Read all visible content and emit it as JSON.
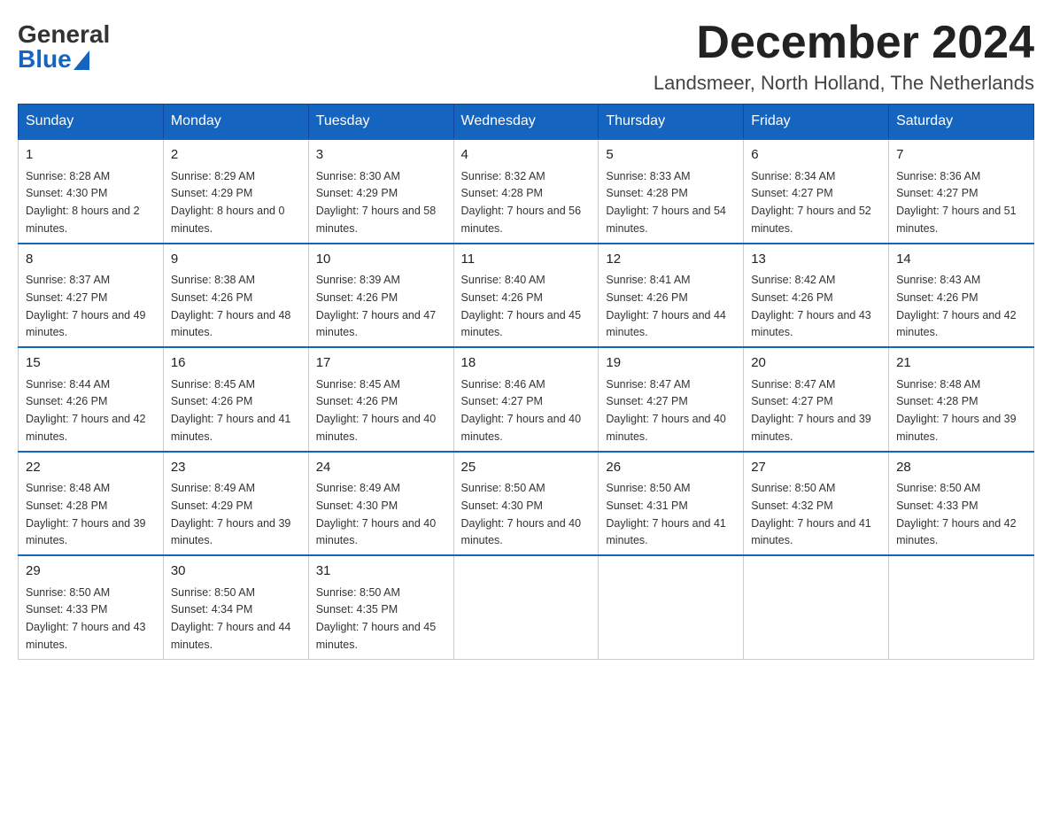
{
  "logo": {
    "general": "General",
    "blue": "Blue"
  },
  "title": "December 2024",
  "location": "Landsmeer, North Holland, The Netherlands",
  "weekdays": [
    "Sunday",
    "Monday",
    "Tuesday",
    "Wednesday",
    "Thursday",
    "Friday",
    "Saturday"
  ],
  "weeks": [
    [
      {
        "day": "1",
        "sunrise": "8:28 AM",
        "sunset": "4:30 PM",
        "daylight": "8 hours and 2 minutes."
      },
      {
        "day": "2",
        "sunrise": "8:29 AM",
        "sunset": "4:29 PM",
        "daylight": "8 hours and 0 minutes."
      },
      {
        "day": "3",
        "sunrise": "8:30 AM",
        "sunset": "4:29 PM",
        "daylight": "7 hours and 58 minutes."
      },
      {
        "day": "4",
        "sunrise": "8:32 AM",
        "sunset": "4:28 PM",
        "daylight": "7 hours and 56 minutes."
      },
      {
        "day": "5",
        "sunrise": "8:33 AM",
        "sunset": "4:28 PM",
        "daylight": "7 hours and 54 minutes."
      },
      {
        "day": "6",
        "sunrise": "8:34 AM",
        "sunset": "4:27 PM",
        "daylight": "7 hours and 52 minutes."
      },
      {
        "day": "7",
        "sunrise": "8:36 AM",
        "sunset": "4:27 PM",
        "daylight": "7 hours and 51 minutes."
      }
    ],
    [
      {
        "day": "8",
        "sunrise": "8:37 AM",
        "sunset": "4:27 PM",
        "daylight": "7 hours and 49 minutes."
      },
      {
        "day": "9",
        "sunrise": "8:38 AM",
        "sunset": "4:26 PM",
        "daylight": "7 hours and 48 minutes."
      },
      {
        "day": "10",
        "sunrise": "8:39 AM",
        "sunset": "4:26 PM",
        "daylight": "7 hours and 47 minutes."
      },
      {
        "day": "11",
        "sunrise": "8:40 AM",
        "sunset": "4:26 PM",
        "daylight": "7 hours and 45 minutes."
      },
      {
        "day": "12",
        "sunrise": "8:41 AM",
        "sunset": "4:26 PM",
        "daylight": "7 hours and 44 minutes."
      },
      {
        "day": "13",
        "sunrise": "8:42 AM",
        "sunset": "4:26 PM",
        "daylight": "7 hours and 43 minutes."
      },
      {
        "day": "14",
        "sunrise": "8:43 AM",
        "sunset": "4:26 PM",
        "daylight": "7 hours and 42 minutes."
      }
    ],
    [
      {
        "day": "15",
        "sunrise": "8:44 AM",
        "sunset": "4:26 PM",
        "daylight": "7 hours and 42 minutes."
      },
      {
        "day": "16",
        "sunrise": "8:45 AM",
        "sunset": "4:26 PM",
        "daylight": "7 hours and 41 minutes."
      },
      {
        "day": "17",
        "sunrise": "8:45 AM",
        "sunset": "4:26 PM",
        "daylight": "7 hours and 40 minutes."
      },
      {
        "day": "18",
        "sunrise": "8:46 AM",
        "sunset": "4:27 PM",
        "daylight": "7 hours and 40 minutes."
      },
      {
        "day": "19",
        "sunrise": "8:47 AM",
        "sunset": "4:27 PM",
        "daylight": "7 hours and 40 minutes."
      },
      {
        "day": "20",
        "sunrise": "8:47 AM",
        "sunset": "4:27 PM",
        "daylight": "7 hours and 39 minutes."
      },
      {
        "day": "21",
        "sunrise": "8:48 AM",
        "sunset": "4:28 PM",
        "daylight": "7 hours and 39 minutes."
      }
    ],
    [
      {
        "day": "22",
        "sunrise": "8:48 AM",
        "sunset": "4:28 PM",
        "daylight": "7 hours and 39 minutes."
      },
      {
        "day": "23",
        "sunrise": "8:49 AM",
        "sunset": "4:29 PM",
        "daylight": "7 hours and 39 minutes."
      },
      {
        "day": "24",
        "sunrise": "8:49 AM",
        "sunset": "4:30 PM",
        "daylight": "7 hours and 40 minutes."
      },
      {
        "day": "25",
        "sunrise": "8:50 AM",
        "sunset": "4:30 PM",
        "daylight": "7 hours and 40 minutes."
      },
      {
        "day": "26",
        "sunrise": "8:50 AM",
        "sunset": "4:31 PM",
        "daylight": "7 hours and 41 minutes."
      },
      {
        "day": "27",
        "sunrise": "8:50 AM",
        "sunset": "4:32 PM",
        "daylight": "7 hours and 41 minutes."
      },
      {
        "day": "28",
        "sunrise": "8:50 AM",
        "sunset": "4:33 PM",
        "daylight": "7 hours and 42 minutes."
      }
    ],
    [
      {
        "day": "29",
        "sunrise": "8:50 AM",
        "sunset": "4:33 PM",
        "daylight": "7 hours and 43 minutes."
      },
      {
        "day": "30",
        "sunrise": "8:50 AM",
        "sunset": "4:34 PM",
        "daylight": "7 hours and 44 minutes."
      },
      {
        "day": "31",
        "sunrise": "8:50 AM",
        "sunset": "4:35 PM",
        "daylight": "7 hours and 45 minutes."
      },
      null,
      null,
      null,
      null
    ]
  ]
}
